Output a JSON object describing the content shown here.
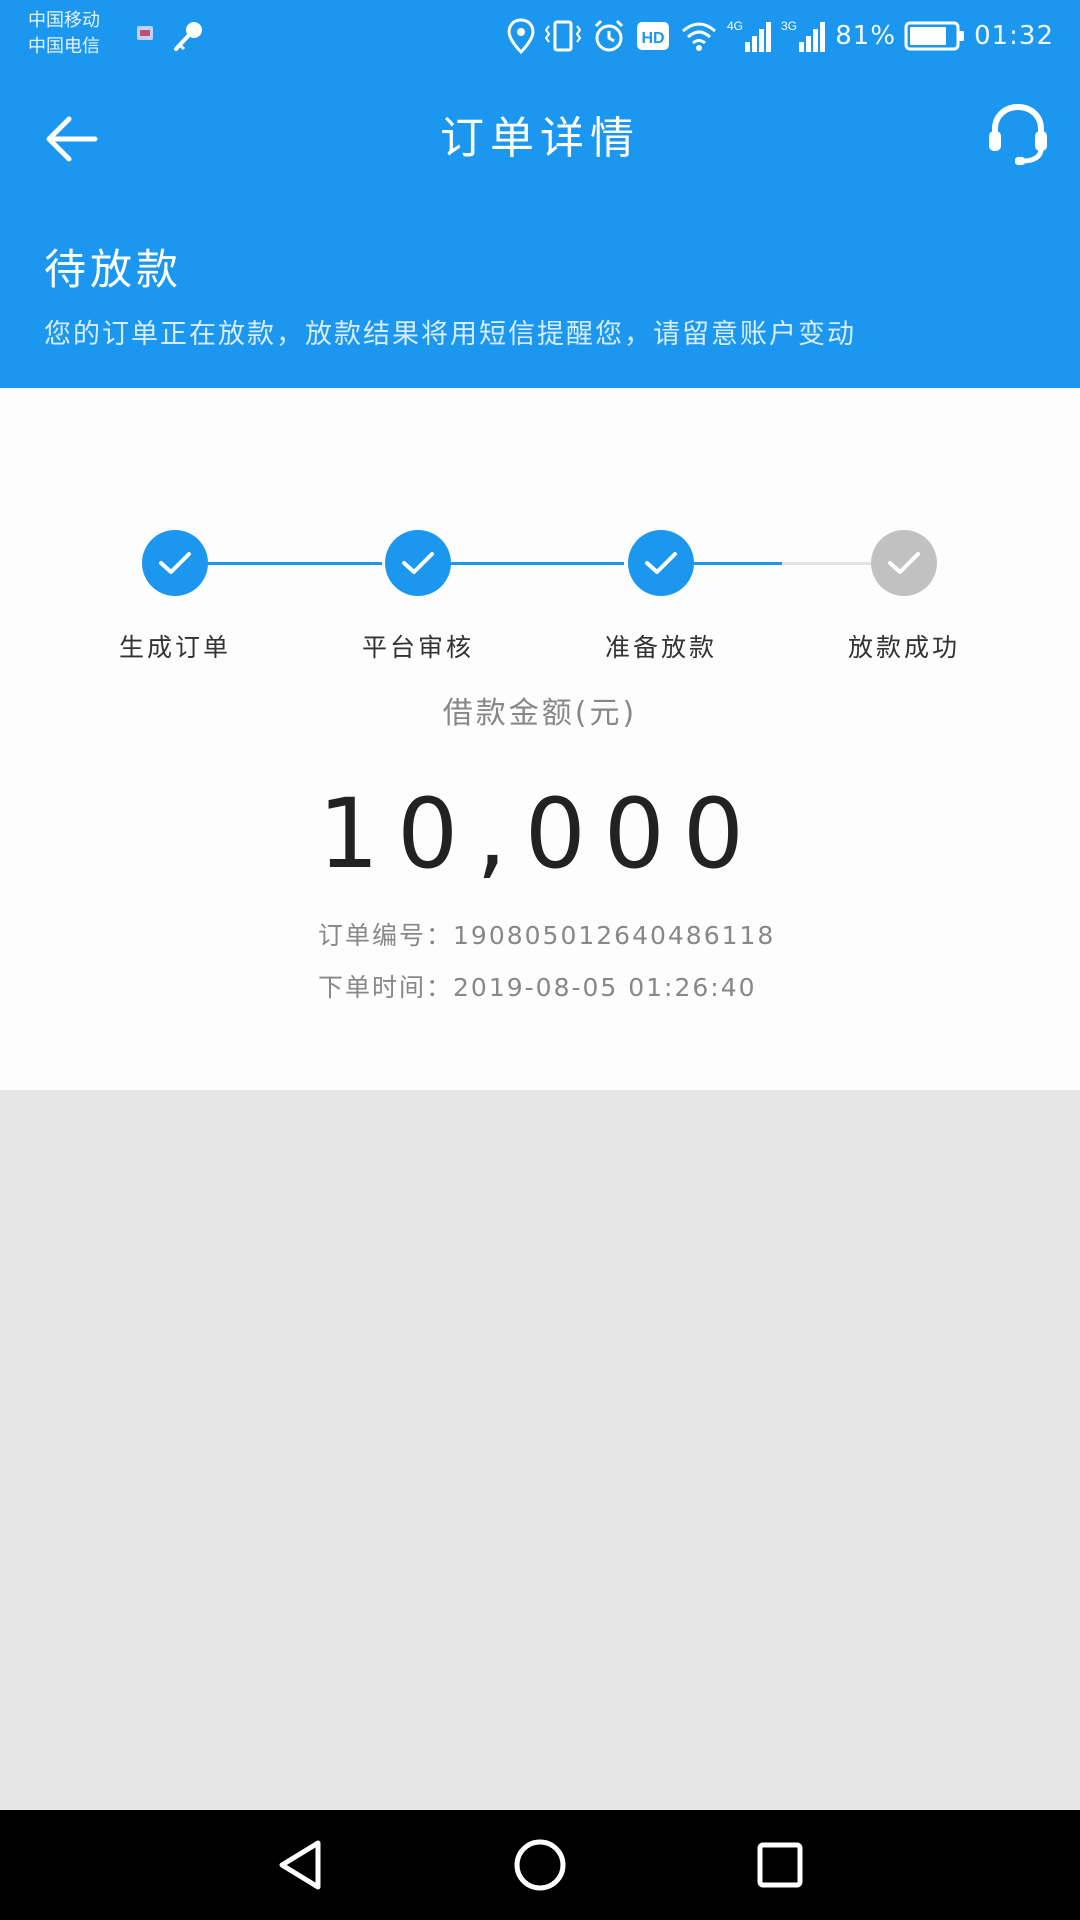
{
  "status_bar": {
    "carrier_1": "中国移动",
    "carrier_2": "中国电信",
    "battery": "81%",
    "time": "01:32",
    "network_1": "4G",
    "network_2": "3G",
    "icons": [
      "location-icon",
      "vibrate-icon",
      "alarm-icon",
      "hd-icon",
      "wifi-icon",
      "signal-icon",
      "signal-icon",
      "battery-icon"
    ]
  },
  "header": {
    "title": "订单详情",
    "back_icon": "arrow-left-icon",
    "service_icon": "headset-icon",
    "status_title": "待放款",
    "status_desc": "您的订单正在放款，放款结果将用短信提醒您，请留意账户变动"
  },
  "progress": {
    "steps": [
      {
        "label": "生成订单",
        "done": true
      },
      {
        "label": "平台审核",
        "done": true
      },
      {
        "label": "准备放款",
        "done": true
      },
      {
        "label": "放款成功",
        "done": false
      }
    ],
    "colors": {
      "done": "#1c97ef",
      "pending": "#c1c1c1",
      "pending_line": "#e4e4e4"
    }
  },
  "order": {
    "amount_label": "借款金额(元)",
    "amount": "10,000",
    "order_no_label": "订单编号：",
    "order_no": "190805012640486118",
    "order_time_label": "下单时间：",
    "order_time": "2019-08-05 01:26:40"
  },
  "navbar": {
    "icons": [
      "back-triangle-icon",
      "home-circle-icon",
      "recents-square-icon"
    ]
  },
  "colors": {
    "brand": "#1c97ef",
    "background": "#e6e6e6"
  }
}
